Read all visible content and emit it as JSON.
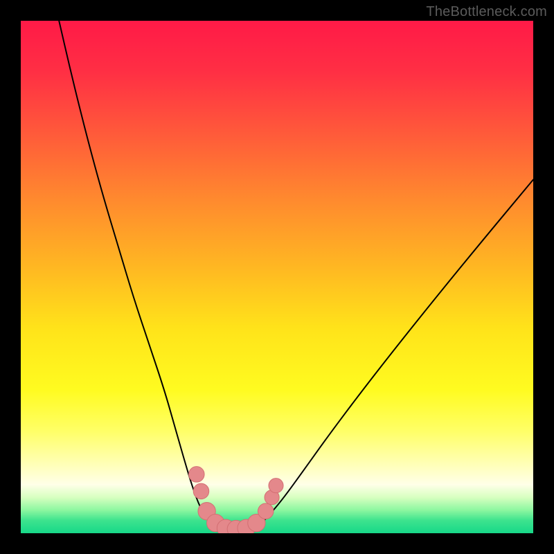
{
  "watermark": "TheBottleneck.com",
  "colors": {
    "frame": "#000000",
    "curve": "#000000",
    "marker_fill": "#e4888b",
    "marker_stroke": "#d36f73",
    "gradient_stops": [
      {
        "offset": 0.0,
        "color": "#ff1a47"
      },
      {
        "offset": 0.1,
        "color": "#ff2f44"
      },
      {
        "offset": 0.22,
        "color": "#ff5a3a"
      },
      {
        "offset": 0.35,
        "color": "#ff8a2e"
      },
      {
        "offset": 0.48,
        "color": "#ffb722"
      },
      {
        "offset": 0.6,
        "color": "#ffe31a"
      },
      {
        "offset": 0.72,
        "color": "#fffb20"
      },
      {
        "offset": 0.8,
        "color": "#ffff66"
      },
      {
        "offset": 0.86,
        "color": "#ffffb0"
      },
      {
        "offset": 0.905,
        "color": "#ffffe8"
      },
      {
        "offset": 0.93,
        "color": "#d7ffc0"
      },
      {
        "offset": 0.955,
        "color": "#8cf7a0"
      },
      {
        "offset": 0.975,
        "color": "#3de38e"
      },
      {
        "offset": 1.0,
        "color": "#17d888"
      }
    ]
  },
  "chart_data": {
    "type": "line",
    "title": "",
    "xlabel": "",
    "ylabel": "",
    "xlim": [
      0,
      100
    ],
    "ylim": [
      0,
      100
    ],
    "grid": false,
    "legend": false,
    "series": [
      {
        "name": "left-curve",
        "x": [
          7,
          10,
          13,
          16,
          19,
          22,
          25,
          28,
          30,
          32,
          33.5,
          35,
          36.5,
          38
        ],
        "y": [
          102,
          89,
          77,
          66,
          56,
          46,
          37,
          28,
          21,
          14,
          9,
          5,
          2.5,
          1
        ]
      },
      {
        "name": "right-curve",
        "x": [
          46,
          48,
          51,
          55,
          60,
          66,
          73,
          81,
          90,
          100
        ],
        "y": [
          1,
          3,
          6.5,
          12,
          19,
          27,
          36,
          46,
          57,
          69
        ]
      },
      {
        "name": "valley-floor",
        "x": [
          38,
          40,
          42,
          44,
          46
        ],
        "y": [
          1,
          0.5,
          0.4,
          0.5,
          1
        ]
      }
    ],
    "markers": [
      {
        "x": 34.3,
        "y": 11.5,
        "r": 1.6
      },
      {
        "x": 35.2,
        "y": 8.2,
        "r": 1.6
      },
      {
        "x": 36.3,
        "y": 4.3,
        "r": 1.8
      },
      {
        "x": 38.0,
        "y": 2.0,
        "r": 1.8
      },
      {
        "x": 40.0,
        "y": 1.0,
        "r": 1.8
      },
      {
        "x": 42.0,
        "y": 0.8,
        "r": 1.8
      },
      {
        "x": 44.0,
        "y": 1.0,
        "r": 1.8
      },
      {
        "x": 46.0,
        "y": 2.0,
        "r": 1.8
      },
      {
        "x": 47.8,
        "y": 4.3,
        "r": 1.6
      },
      {
        "x": 49.0,
        "y": 7.0,
        "r": 1.5
      },
      {
        "x": 49.8,
        "y": 9.3,
        "r": 1.5
      }
    ]
  }
}
